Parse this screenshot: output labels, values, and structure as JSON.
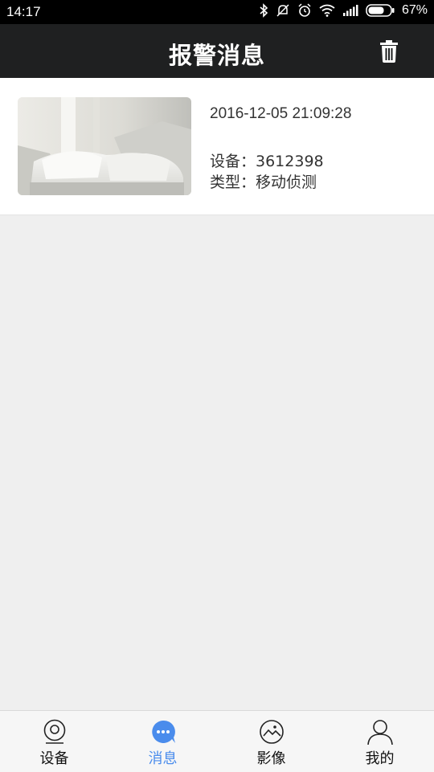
{
  "status_bar": {
    "time": "14:17",
    "battery": "67%",
    "icons": [
      "bluetooth-icon",
      "mute-icon",
      "alarm-icon",
      "wifi-icon",
      "signal-icon",
      "battery-icon"
    ]
  },
  "header": {
    "title": "报警消息",
    "delete_icon": "trash-icon"
  },
  "messages": [
    {
      "time": "2016-12-05 21:09:28",
      "device": "设备：3612398",
      "type": "类型：移动侦测"
    }
  ],
  "nav": {
    "active": "消息",
    "tabs": [
      {
        "label": "设备",
        "icon": "camera-icon"
      },
      {
        "label": "消息",
        "icon": "chat-icon"
      },
      {
        "label": "影像",
        "icon": "image-icon"
      },
      {
        "label": "我的",
        "icon": "user-icon"
      }
    ]
  },
  "colors": {
    "header_bg": "#1f2021",
    "accent": "#4a8cec",
    "page_bg": "#efefef"
  }
}
